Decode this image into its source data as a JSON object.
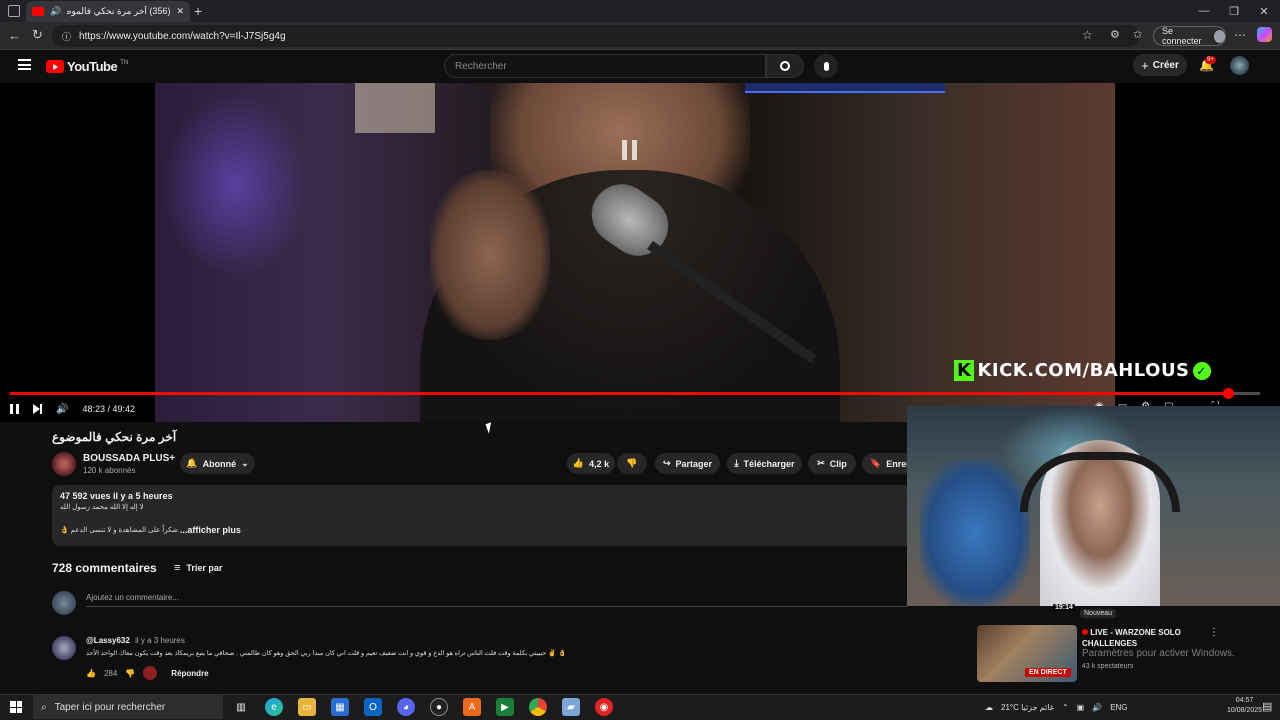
{
  "browser": {
    "tab_title": "(356) آخر مرة نحكي فالموضوع",
    "url": "https://www.youtube.com/watch?v=Il-J7Sj5g4g",
    "signin_label": "Se connecter"
  },
  "youtube": {
    "logo_text": "YouTube",
    "logo_sup": "TN",
    "search_placeholder": "Rechercher",
    "create_label": "Créer",
    "notif_badge": "9+"
  },
  "video": {
    "overlay_text": "KICK.COM/BAHLOUS",
    "time_current": "48:23",
    "time_total": "49:42",
    "progress_fraction": 0.974,
    "time_display": "48:23 / 49:42"
  },
  "info": {
    "title": "آخر مرة نحكي فالموضوع",
    "channel_name": "BOUSSADA PLUS+",
    "subscribers": "120 k abonnés",
    "subscribed_label": "Abonné",
    "like_count": "4,2 k",
    "share_label": "Partager",
    "download_label": "Télécharger",
    "clip_label": "Clip",
    "save_label": "Enreg"
  },
  "description": {
    "meta": "47 592 vues  il y a 5 heures",
    "line1": "لا إله إلا الله محمد رسول الله",
    "line2": "شكراً على المشاهدة و لا تنسى الدعم 👌",
    "more_label": "...afficher plus"
  },
  "comments": {
    "count_label": "728 commentaires",
    "sort_label": "Trier par",
    "add_placeholder": "Ajoutez un commentaire...",
    "items": [
      {
        "user": "@Lassy632",
        "time": "il y a 3 heures",
        "text": "👌 ✌️ حبيبتي بكلمة وقت قلت الناس تراه هو الدع و قوي و انت ضعيف تعيم و قلت اني كان مبدا ربي الحق وهو كان ظالمني . صحافي ما يتبع بريمكاد بعد وقت يكون معاك الواحد الأحد",
        "likes": "284",
        "reply_label": "Répondre"
      }
    ]
  },
  "sidebar": {
    "badge": "Nouveau",
    "duration": "19:14",
    "live_title": "LIVE - WARZONE SOLO CHALLENGES",
    "spectators": "43 k spectateurs",
    "live_badge": "EN DIRECT",
    "windows_watermark": "Paramètres pour activer Windows."
  },
  "taskbar": {
    "search_placeholder": "Taper ici pour rechercher",
    "weather": "21°C  غائم جزئيا",
    "lang": "ENG",
    "time": "04:57",
    "date": "10/08/2025"
  }
}
